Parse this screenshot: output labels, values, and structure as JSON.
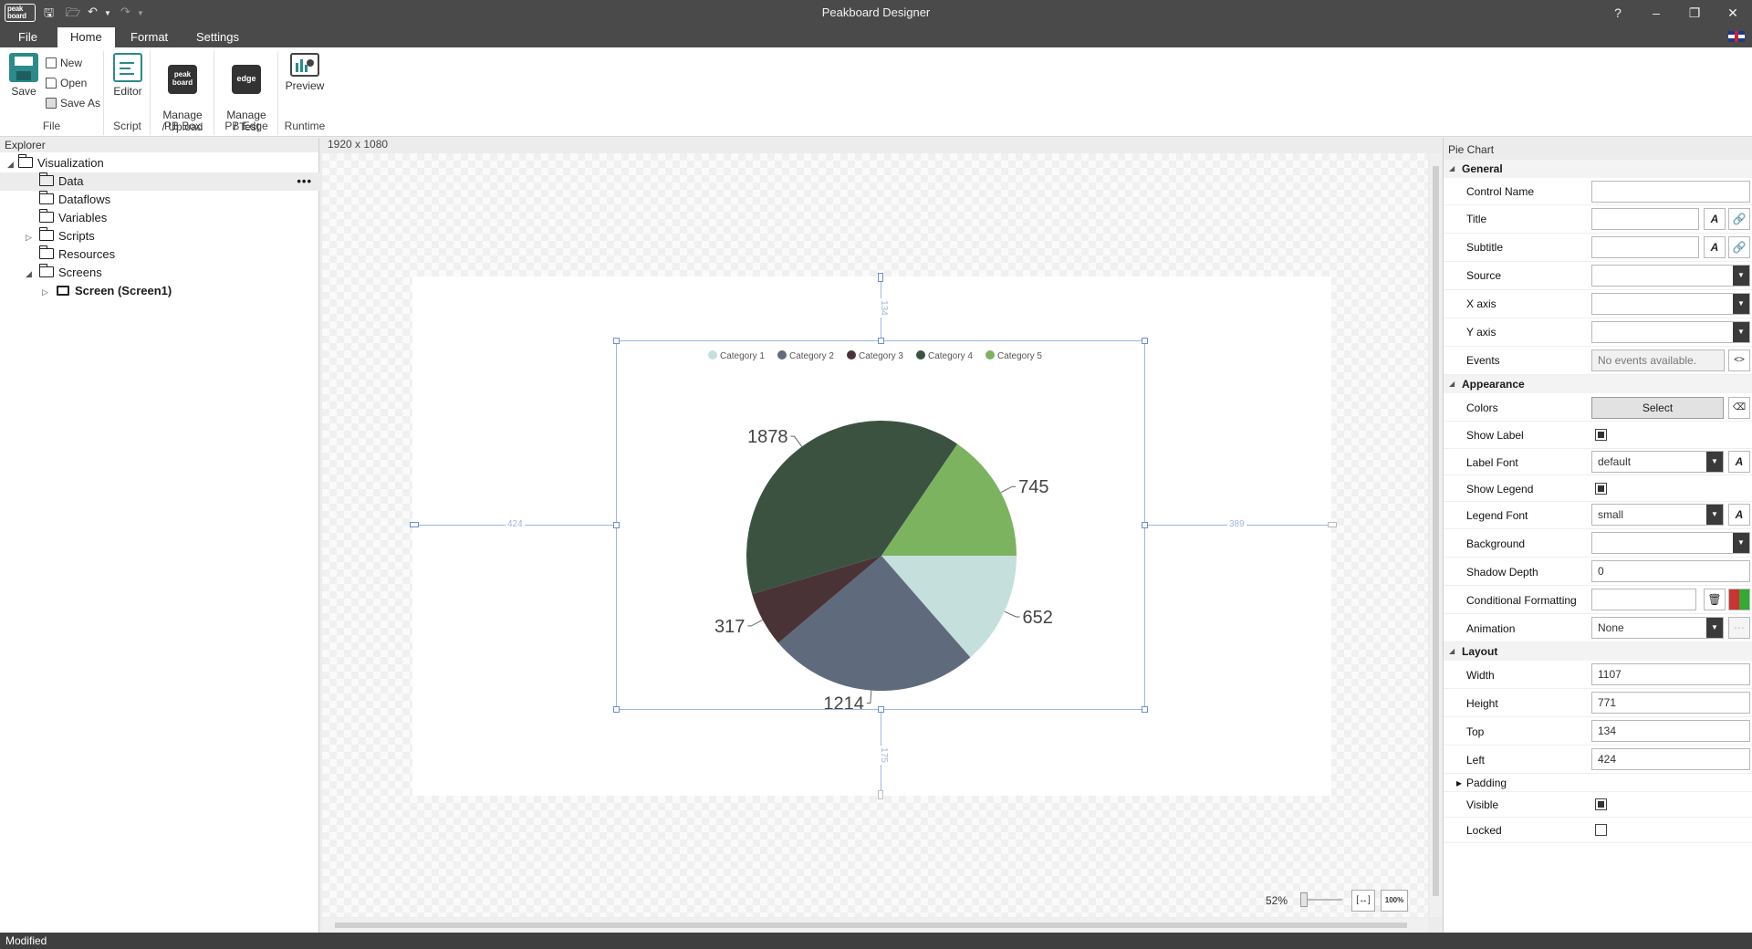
{
  "window": {
    "title": "Peakboard Designer",
    "logo_text": "peak board",
    "help": "?",
    "minimize": "–",
    "restore": "❐",
    "close": "✕"
  },
  "tabs": [
    {
      "label": "File"
    },
    {
      "label": "Home"
    },
    {
      "label": "Format"
    },
    {
      "label": "Settings"
    }
  ],
  "ribbon": {
    "file_group": {
      "label": "File",
      "save": "Save",
      "new": "New",
      "open": "Open",
      "save_as": "Save As"
    },
    "script_group": {
      "label": "Script",
      "editor": "Editor"
    },
    "pbbox_group": {
      "label": "PB Box",
      "manage": "Manage\n/ Upload",
      "icon_text": "peak board"
    },
    "pbedge_group": {
      "label": "PB Edge",
      "manage": "Manage\n/ Test",
      "icon_text": "edge"
    },
    "runtime_group": {
      "label": "Runtime",
      "preview": "Preview"
    }
  },
  "explorer": {
    "title": "Explorer",
    "items": [
      {
        "label": "Visualization"
      },
      {
        "label": "Data"
      },
      {
        "label": "Dataflows"
      },
      {
        "label": "Variables"
      },
      {
        "label": "Scripts"
      },
      {
        "label": "Resources"
      },
      {
        "label": "Screens"
      },
      {
        "label": "Screen (Screen1)"
      }
    ],
    "more": "•••"
  },
  "canvas": {
    "resolution": "1920 x 1080",
    "guides": {
      "top": "134",
      "left": "424",
      "right": "389",
      "bottom": "175"
    },
    "zoom": "52%"
  },
  "chart_data": {
    "type": "pie",
    "categories": [
      "Category 1",
      "Category 2",
      "Category 3",
      "Category 4",
      "Category 5"
    ],
    "values": [
      652,
      1214,
      317,
      1878,
      745
    ],
    "colors": [
      "#c5e0dc",
      "#5f6b7d",
      "#4a3336",
      "#3b5241",
      "#7bb35f"
    ],
    "data_labels": [
      "652",
      "1214",
      "317",
      "1878",
      "745"
    ],
    "legend_position": "top",
    "start_angle_deg": 0,
    "direction": "clockwise"
  },
  "properties": {
    "title": "Pie Chart",
    "general": {
      "label": "General",
      "control_name": {
        "label": "Control Name",
        "value": ""
      },
      "title": {
        "label": "Title",
        "value": ""
      },
      "subtitle": {
        "label": "Subtitle",
        "value": ""
      },
      "source": {
        "label": "Source",
        "value": ""
      },
      "x_axis": {
        "label": "X axis",
        "value": ""
      },
      "y_axis": {
        "label": "Y axis",
        "value": ""
      },
      "events": {
        "label": "Events",
        "value": "No events available."
      }
    },
    "appearance": {
      "label": "Appearance",
      "colors": {
        "label": "Colors",
        "button": "Select"
      },
      "show_label": {
        "label": "Show Label",
        "checked": true
      },
      "label_font": {
        "label": "Label Font",
        "value": "default"
      },
      "show_legend": {
        "label": "Show Legend",
        "checked": true
      },
      "legend_font": {
        "label": "Legend Font",
        "value": "small"
      },
      "background": {
        "label": "Background",
        "value": ""
      },
      "shadow_depth": {
        "label": "Shadow Depth",
        "value": "0"
      },
      "conditional_formatting": {
        "label": "Conditional Formatting",
        "value": ""
      },
      "animation": {
        "label": "Animation",
        "value": "None"
      }
    },
    "layout": {
      "label": "Layout",
      "width": {
        "label": "Width",
        "value": "1107"
      },
      "height": {
        "label": "Height",
        "value": "771"
      },
      "top": {
        "label": "Top",
        "value": "134"
      },
      "left": {
        "label": "Left",
        "value": "424"
      },
      "padding": {
        "label": "Padding"
      },
      "visible": {
        "label": "Visible",
        "checked": true
      },
      "locked": {
        "label": "Locked",
        "checked": false
      }
    }
  },
  "status": {
    "text": "Modified"
  }
}
